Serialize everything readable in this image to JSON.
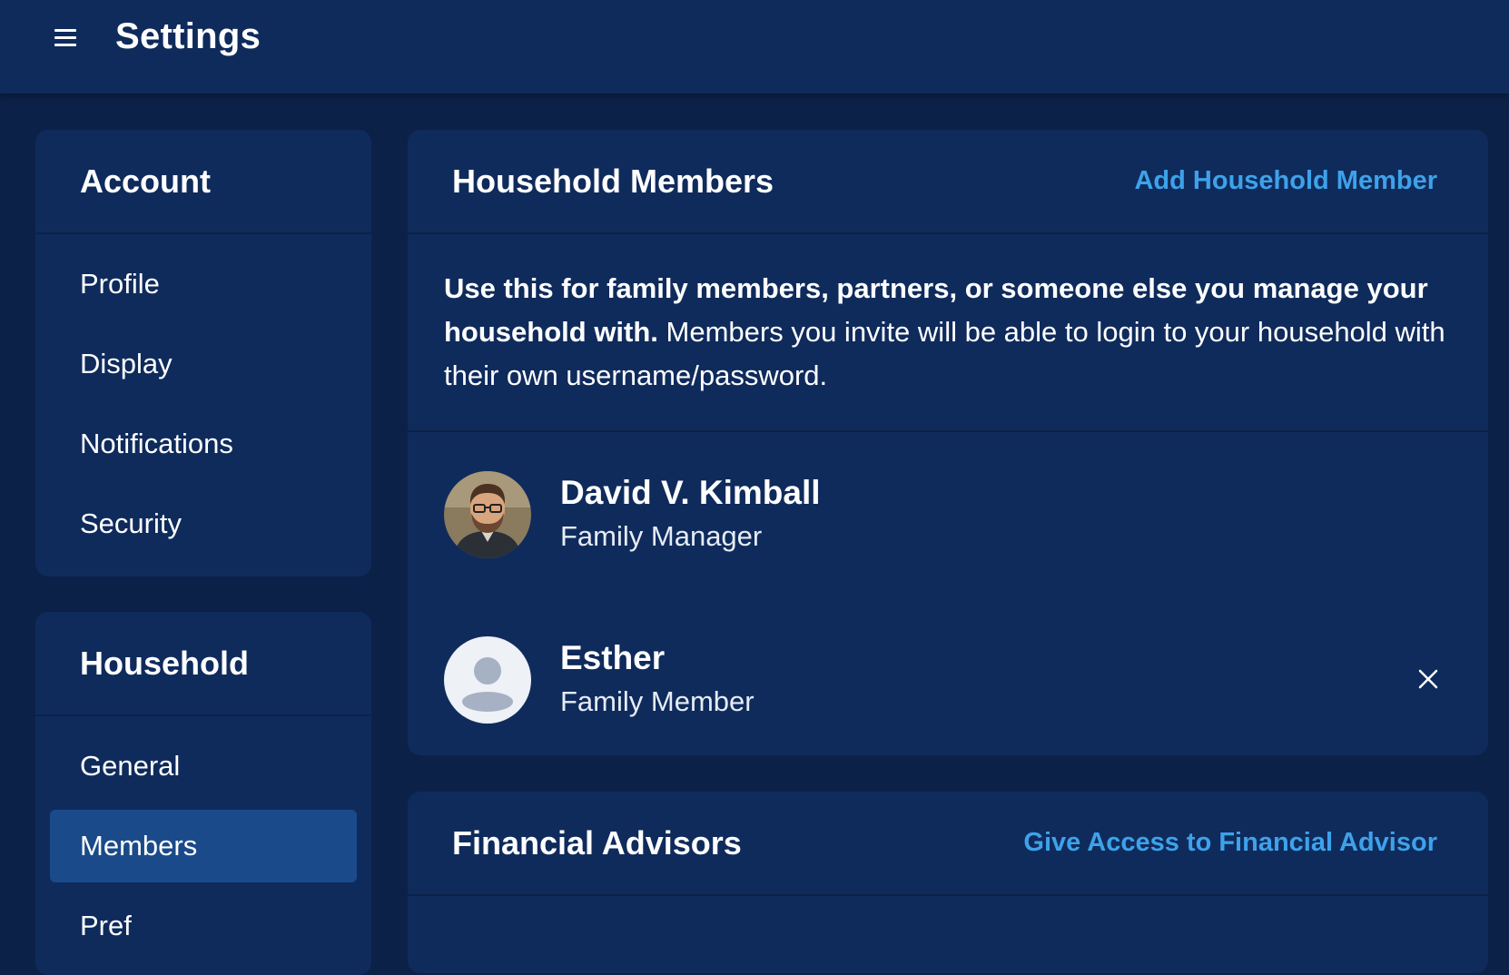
{
  "header": {
    "title": "Settings",
    "menu_icon": "hamburger-menu-icon"
  },
  "sidebar": {
    "account": {
      "heading": "Account",
      "items": [
        {
          "label": "Profile"
        },
        {
          "label": "Display"
        },
        {
          "label": "Notifications"
        },
        {
          "label": "Security"
        }
      ]
    },
    "household": {
      "heading": "Household",
      "items": [
        {
          "label": "General",
          "active": false
        },
        {
          "label": "Members",
          "active": true
        },
        {
          "label": "Pref"
        }
      ]
    }
  },
  "members_card": {
    "title": "Household Members",
    "action": "Add Household Member",
    "intro_bold": "Use this for family members, partners, or someone else you manage your household with.",
    "intro_rest": " Members you invite will be able to login to your household with their own username/password.",
    "members": [
      {
        "name": "David V. Kimball",
        "role": "Family Manager",
        "avatar_icon": "photo-avatar",
        "removable": false
      },
      {
        "name": "Esther",
        "role": "Family Member",
        "avatar_icon": "default-user-avatar-icon",
        "removable": true,
        "remove_icon": "close-icon"
      }
    ]
  },
  "advisors_card": {
    "title": "Financial Advisors",
    "action": "Give Access to Financial Advisor"
  },
  "colors": {
    "background": "#0c2147",
    "panel": "#0f2b5c",
    "active_item": "#1a4a8a",
    "link": "#3ea2ea",
    "text": "#ffffff"
  }
}
